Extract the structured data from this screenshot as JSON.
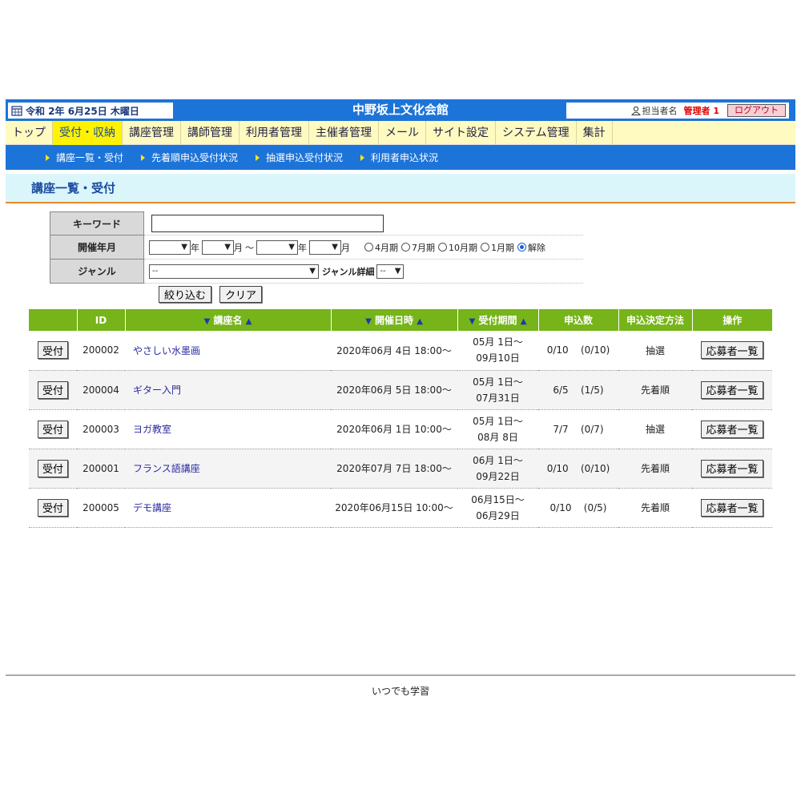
{
  "header": {
    "date": "令和 2年 6月25日 木曜日",
    "site_title": "中野坂上文化会館",
    "user_label": "担当者名",
    "user_name": "管理者 1",
    "logout_label": "ログアウト"
  },
  "nav": {
    "items": [
      "トップ",
      "受付・収納",
      "講座管理",
      "講師管理",
      "利用者管理",
      "主催者管理",
      "メール",
      "サイト設定",
      "システム管理",
      "集計"
    ]
  },
  "subnav": {
    "items": [
      "講座一覧・受付",
      "先着順申込受付状況",
      "抽選申込受付状況",
      "利用者申込状況"
    ]
  },
  "page": {
    "title": "講座一覧・受付"
  },
  "filter": {
    "keyword_label": "キーワード",
    "keyword_value": "",
    "date_label": "開催年月",
    "year_unit": "年",
    "month_unit": "月",
    "tilde": "～",
    "periods": [
      "4月期",
      "7月期",
      "10月期",
      "1月期",
      "解除"
    ],
    "genre_label": "ジャンル",
    "genre_value": "--",
    "genre_detail_label": "ジャンル詳細",
    "genre_detail_value": "--",
    "filter_button": "絞り込む",
    "clear_button": "クリア"
  },
  "table": {
    "headers": {
      "id": "ID",
      "name": "講座名",
      "date": "開催日時",
      "period": "受付期間",
      "count": "申込数",
      "method": "申込決定方法",
      "action": "操作"
    },
    "receive_label": "受付",
    "applicants_label": "応募者一覧",
    "rows": [
      {
        "id": "200002",
        "name": "やさしい水墨画",
        "date": "2020年06月 4日 18:00～",
        "period_start": "05月 1日～",
        "period_end": "09月10日",
        "count": "0/10",
        "sub": "(0/10)",
        "method": "抽選"
      },
      {
        "id": "200004",
        "name": "ギター入門",
        "date": "2020年06月 5日 18:00～",
        "period_start": "05月 1日～",
        "period_end": "07月31日",
        "count": "6/5",
        "sub": "(1/5)",
        "method": "先着順"
      },
      {
        "id": "200003",
        "name": "ヨガ教室",
        "date": "2020年06月 1日 10:00～",
        "period_start": "05月 1日～",
        "period_end": "08月 8日",
        "count": "7/7",
        "sub": "(0/7)",
        "method": "抽選"
      },
      {
        "id": "200001",
        "name": "フランス語講座",
        "date": "2020年07月 7日 18:00～",
        "period_start": "06月 1日～",
        "period_end": "09月22日",
        "count": "0/10",
        "sub": "(0/10)",
        "method": "先着順"
      },
      {
        "id": "200005",
        "name": "デモ講座",
        "date": "2020年06月15日 10:00～",
        "period_start": "06月15日～",
        "period_end": "06月29日",
        "count": "0/10",
        "sub": "(0/5)",
        "method": "先着順"
      }
    ]
  },
  "footer": {
    "text": "いつでも学習"
  }
}
